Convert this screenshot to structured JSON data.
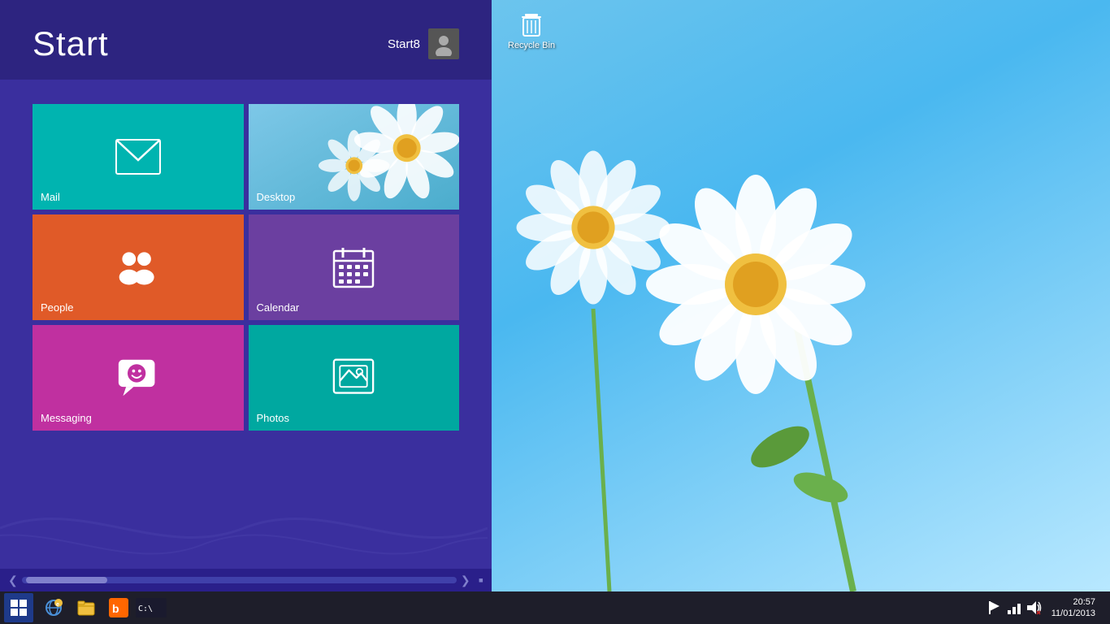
{
  "desktop": {
    "background": "#4fc3f7"
  },
  "start_panel": {
    "title": "Start",
    "background": "#3a2f9e"
  },
  "user": {
    "name": "Start8"
  },
  "tiles": [
    {
      "id": "mail",
      "label": "Mail",
      "color": "#00b4b0"
    },
    {
      "id": "desktop",
      "label": "Desktop",
      "color": "#4a9a6a"
    },
    {
      "id": "people",
      "label": "People",
      "color": "#e05a28"
    },
    {
      "id": "calendar",
      "label": "Calendar",
      "color": "#6b3fa0"
    },
    {
      "id": "messaging",
      "label": "Messaging",
      "color": "#c030a0"
    },
    {
      "id": "photos",
      "label": "Photos",
      "color": "#00a8a0"
    }
  ],
  "taskbar": {
    "start_label": "⊞",
    "apps": [
      {
        "id": "ie",
        "label": "Internet Explorer"
      },
      {
        "id": "explorer",
        "label": "File Explorer"
      },
      {
        "id": "bing",
        "label": "Bing"
      },
      {
        "id": "cmd",
        "label": "Command Prompt"
      }
    ],
    "time": "20:57",
    "date": "11/01/2013",
    "system_icons": [
      "flag-icon",
      "network-icon",
      "volume-icon"
    ]
  },
  "recycle_bin": {
    "label": "Recycle Bin"
  },
  "scrollbar": {
    "left_arrow": "❮",
    "right_arrow": "❯",
    "close": "▪"
  }
}
